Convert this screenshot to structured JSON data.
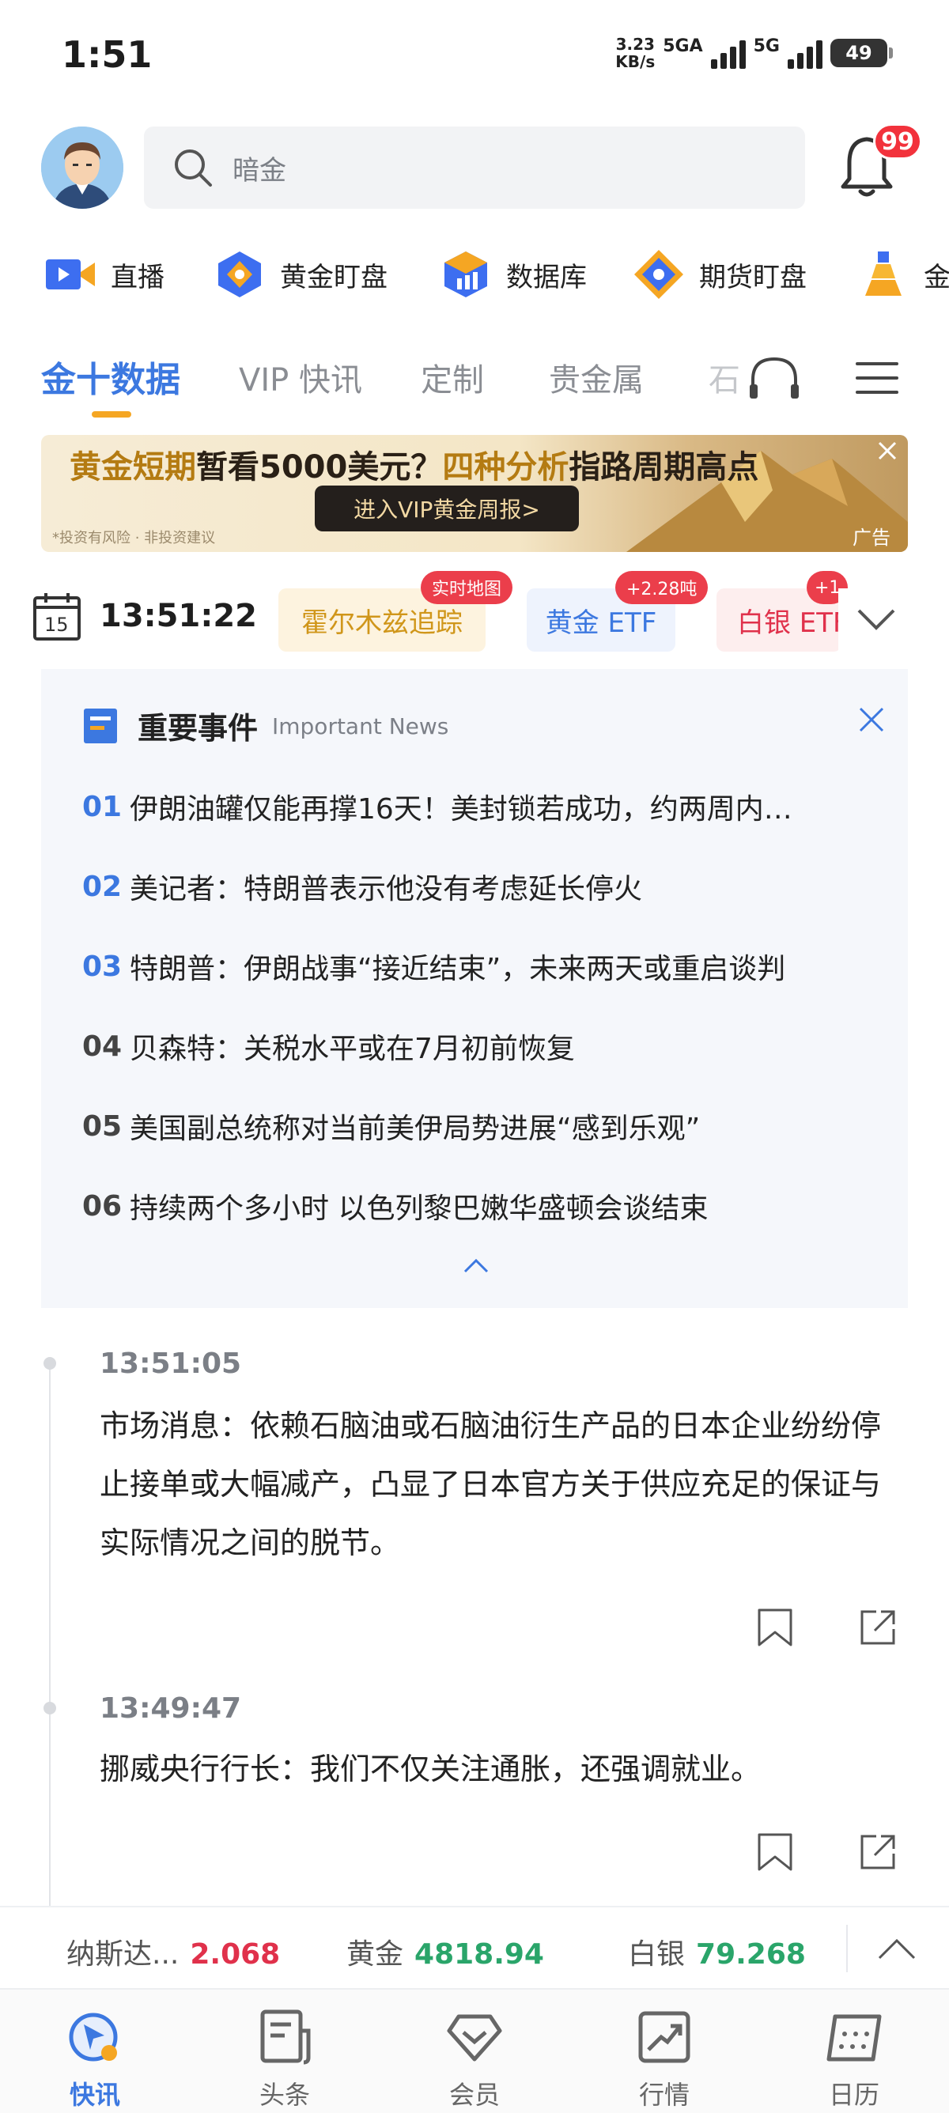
{
  "status_bar": {
    "time": "1:51",
    "net_speed_value": "3.23",
    "net_speed_unit": "KB/s",
    "signal1_label": "5GA",
    "signal2_label": "5G",
    "battery": "49"
  },
  "header": {
    "search_placeholder": "暗金",
    "notification_badge": "99"
  },
  "tools": [
    {
      "label": "直播",
      "icon": "live-video-icon"
    },
    {
      "label": "黄金盯盘",
      "icon": "gold-watch-icon"
    },
    {
      "label": "数据库",
      "icon": "database-icon"
    },
    {
      "label": "期货盯盘",
      "icon": "futures-watch-icon"
    },
    {
      "label": "金",
      "icon": "gold-bars-icon"
    }
  ],
  "tabs": [
    "金十数据",
    "VIP 快讯",
    "定制",
    "贵金属",
    "石"
  ],
  "banner": {
    "title_part1": "黄金短期",
    "title_part2": "暂看5000美元？",
    "title_part3": "四种分析",
    "title_part4": "指路周期高点",
    "button": "进入VIP黄金周报>",
    "note": "*投资有风险 · 非投资建议",
    "ad_label": "广告"
  },
  "time_row": {
    "calendar_day": "15",
    "time": "13:51:22",
    "chips": [
      {
        "label": "霍尔木兹追踪",
        "badge": "实时地图"
      },
      {
        "label": "黄金 ETF",
        "badge": "+2.28吨"
      },
      {
        "label": "白银 ETF",
        "badge": "+1"
      }
    ]
  },
  "important": {
    "title": "重要事件",
    "subtitle": "Important News",
    "items": [
      {
        "num": "01",
        "text": "伊朗油罐仅能再撑16天！美封锁若成功，约两周内…"
      },
      {
        "num": "02",
        "text": "美记者：特朗普表示他没有考虑延长停火"
      },
      {
        "num": "03",
        "text": "特朗普：伊朗战事“接近结束”，未来两天或重启谈判"
      },
      {
        "num": "04",
        "text": "贝森特：关税水平或在7月初前恢复"
      },
      {
        "num": "05",
        "text": "美国副总统称对当前美伊局势进展“感到乐观”"
      },
      {
        "num": "06",
        "text": "持续两个多小时 以色列黎巴嫩华盛顿会谈结束"
      }
    ]
  },
  "feed": [
    {
      "time": "13:51:05",
      "text": "市场消息：依赖石脑油或石脑油衍生产品的日本企业纷纷停止接单或大幅减产，凸显了日本官方关于供应充足的保证与实际情况之间的脱节。"
    },
    {
      "time": "13:49:47",
      "text": "挪威央行行长：我们不仅关注通胀，还强调就业。"
    }
  ],
  "ticker": [
    {
      "name": "纳斯达...",
      "value": "2.068",
      "color": "#e0314b"
    },
    {
      "name": "黄金",
      "value": "4818.94",
      "color": "#2aa56a"
    },
    {
      "name": "白银",
      "value": "79.268",
      "color": "#2aa56a"
    }
  ],
  "bottom_nav": [
    {
      "label": "快讯",
      "active": true
    },
    {
      "label": "头条",
      "active": false
    },
    {
      "label": "会员",
      "active": false
    },
    {
      "label": "行情",
      "active": false
    },
    {
      "label": "日历",
      "active": false
    }
  ],
  "colors": {
    "accent": "#3c78e0",
    "tab_underline": "#f5a623",
    "badge": "#f2323c"
  }
}
